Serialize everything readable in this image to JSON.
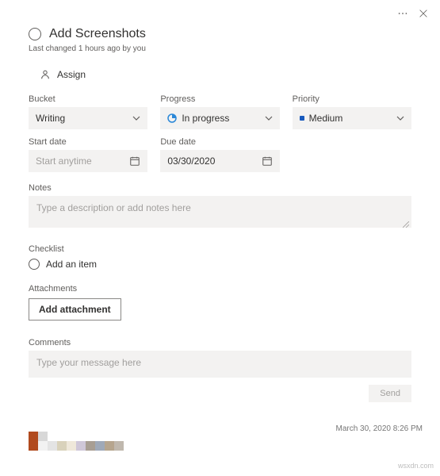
{
  "header": {
    "title": "Add Screenshots",
    "subtitle": "Last changed 1 hours ago by you"
  },
  "assign": {
    "label": "Assign"
  },
  "fields": {
    "bucket": {
      "label": "Bucket",
      "value": "Writing"
    },
    "progress": {
      "label": "Progress",
      "value": "In progress"
    },
    "priority": {
      "label": "Priority",
      "value": "Medium"
    },
    "startDate": {
      "label": "Start date",
      "placeholder": "Start anytime",
      "value": ""
    },
    "dueDate": {
      "label": "Due date",
      "value": "03/30/2020"
    }
  },
  "notes": {
    "label": "Notes",
    "placeholder": "Type a description or add notes here"
  },
  "checklist": {
    "label": "Checklist",
    "addItem": "Add an item"
  },
  "attachments": {
    "label": "Attachments",
    "button": "Add attachment"
  },
  "comments": {
    "label": "Comments",
    "placeholder": "Type your message here",
    "send": "Send"
  },
  "footer": {
    "timestamp": "March 30, 2020 8:26 PM",
    "watermark": "wsxdn.com"
  },
  "palette": [
    [
      "#b14a1e",
      "#d8d8d8"
    ],
    [
      "#b14a1e",
      "#f2f2f2",
      "#e4e4e4",
      "#d9d2bb",
      "#efe8da",
      "#cfc7d8",
      "#a89e93",
      "#9fa9b8",
      "#b6a58e",
      "#c0b8ae"
    ]
  ]
}
